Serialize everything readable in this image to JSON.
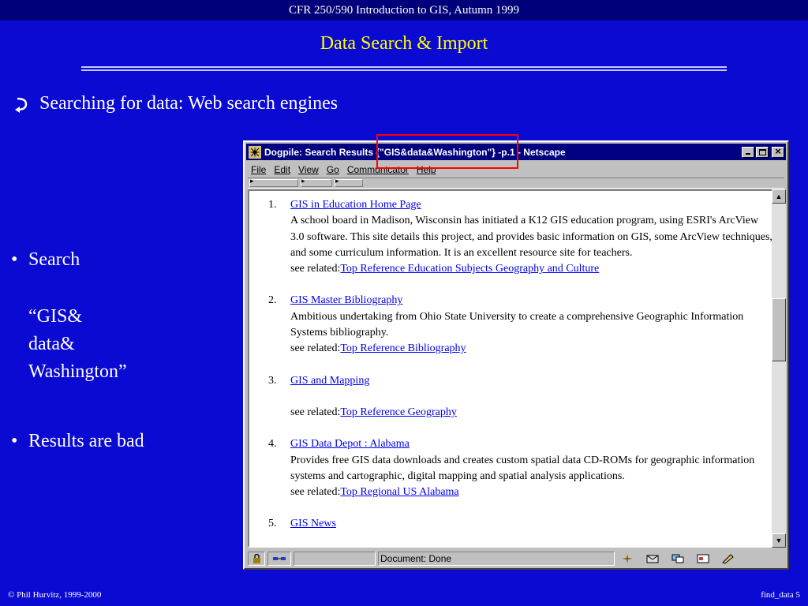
{
  "slide": {
    "header": "CFR 250/590 Introduction to GIS, Autumn 1999",
    "title": "Data Search  & Import",
    "main_bullet": "Searching for data: Web search engines",
    "bullet_search": "Search",
    "query_lines": [
      "“GIS&",
      "data&",
      "Washington”"
    ],
    "bullet_results": "Results are bad",
    "footer_left": "© Phil Hurvitz, 1999-2000",
    "footer_right": "find_data 5",
    "colors": {
      "background": "#0a0ad2",
      "title": "#ffff00",
      "highlight": "#ff0000"
    }
  },
  "browser": {
    "window_title": "Dogpile: Search Results {\"GIS&data&Washington\"} -p.1 - Netscape",
    "menu": [
      "File",
      "Edit",
      "View",
      "Go",
      "Communicator",
      "Help"
    ],
    "results": [
      {
        "num": "1.",
        "link": "GIS in Education Home Page",
        "desc": "A school board in Madison, Wisconsin has initiated a K12 GIS education program, using ESRI's ArcView 3.0 software. This site details this project, and provides basic information on GIS, some ArcView techniques, and some curriculum information. It is an excellent resource site for teachers.",
        "related_prefix": "see related:",
        "related": "Top Reference Education Subjects Geography  and  Culture"
      },
      {
        "num": "2.",
        "link": "GIS Master Bibliography",
        "desc": "Ambitious undertaking from Ohio State University to create a comprehensive Geographic Information Systems bibliography.",
        "related_prefix": "see related:",
        "related": "Top Reference Bibliography"
      },
      {
        "num": "3.",
        "link": "GIS and Mapping",
        "desc": "",
        "related_prefix": "see related:",
        "related": "Top Reference Geography"
      },
      {
        "num": "4.",
        "link": "GIS Data Depot : Alabama",
        "desc": "Provides free GIS data downloads and creates custom spatial data CD-ROMs for geographic information systems and cartographic, digital mapping and spatial analysis applications.",
        "related_prefix": "see related:",
        "related": "Top Regional US Alabama"
      },
      {
        "num": "5.",
        "link": "GIS News",
        "desc": "",
        "related_prefix": "",
        "related": ""
      }
    ],
    "status_text": "Document: Done",
    "icons": {
      "app": "netscape-icon",
      "status": [
        "security-lock-icon",
        "connection-icon",
        "netscape-component-icon",
        "mail-icon",
        "discussion-icon",
        "composer-icon",
        "edit-icon"
      ]
    }
  }
}
